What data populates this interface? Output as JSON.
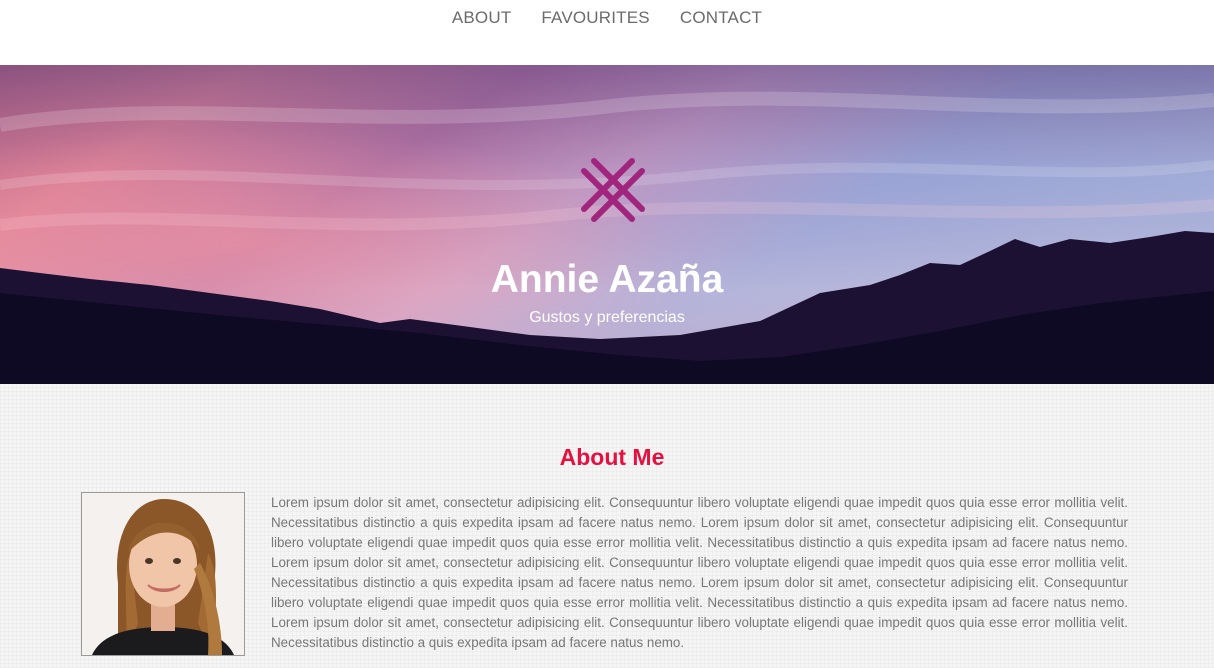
{
  "nav": {
    "items": [
      {
        "label": "ABOUT"
      },
      {
        "label": "FAVOURITES"
      },
      {
        "label": "CONTACT"
      }
    ]
  },
  "hero": {
    "logo_icon": "crosshatch-logo-icon",
    "title": "Annie Azaña",
    "subtitle": "Gustos y preferencias"
  },
  "about": {
    "heading": "About Me",
    "photo_icon": "profile-photo",
    "bio": "Lorem ipsum dolor sit amet, consectetur adipisicing elit. Consequuntur libero voluptate eligendi quae impedit quos quia esse error mollitia velit. Necessitatibus distinctio a quis expedita ipsam ad facere natus nemo. Lorem ipsum dolor sit amet, consectetur adipisicing elit. Consequuntur libero voluptate eligendi quae impedit quos quia esse error mollitia velit. Necessitatibus distinctio a quis expedita ipsam ad facere natus nemo. Lorem ipsum dolor sit amet, consectetur adipisicing elit. Consequuntur libero voluptate eligendi quae impedit quos quia esse error mollitia velit. Necessitatibus distinctio a quis expedita ipsam ad facere natus nemo. Lorem ipsum dolor sit amet, consectetur adipisicing elit. Consequuntur libero voluptate eligendi quae impedit quos quia esse error mollitia velit. Necessitatibus distinctio a quis expedita ipsam ad facere natus nemo. Lorem ipsum dolor sit amet, consectetur adipisicing elit. Consequuntur libero voluptate eligendi quae impedit quos quia esse error mollitia velit. Necessitatibus distinctio a quis expedita ipsam ad facere natus nemo."
  },
  "colors": {
    "accent": "#e5103f",
    "logo": "#a1257d",
    "nav_text": "#6b6b6b",
    "body_text": "#777777"
  }
}
